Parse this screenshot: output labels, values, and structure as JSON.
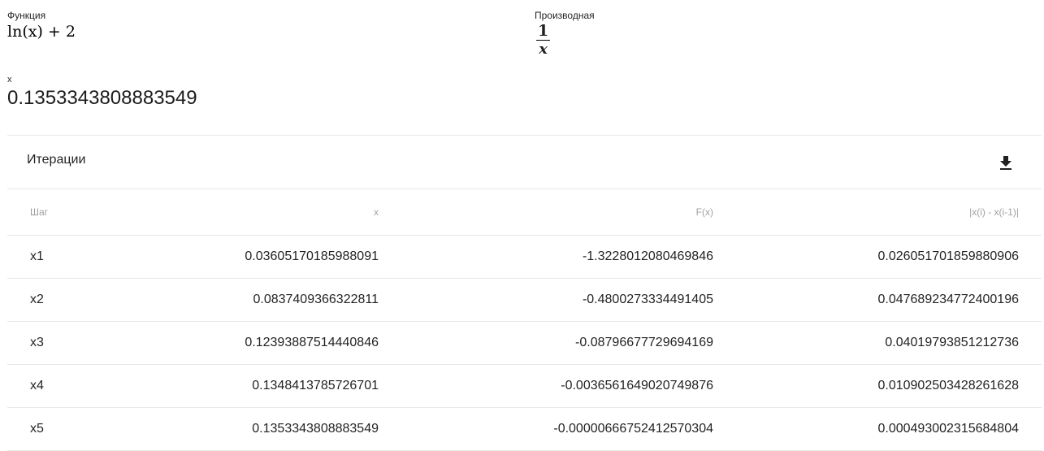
{
  "function": {
    "label": "Функция",
    "expression": "ln(x) + 2"
  },
  "derivative": {
    "label": "Производная",
    "numerator": "1",
    "denominator": "x"
  },
  "result": {
    "label": "x",
    "value": "0.1353343808883549"
  },
  "iterations": {
    "title": "Итерации",
    "download_icon": "download-icon",
    "columns": [
      "Шаг",
      "x",
      "F(x)",
      "|x(i) - x(i-1)|"
    ],
    "rows": [
      [
        "x1",
        "0.03605170185988091",
        "-1.3228012080469846",
        "0.026051701859880906"
      ],
      [
        "x2",
        "0.0837409366322811",
        "-0.4800273334491405",
        "0.047689234772400196"
      ],
      [
        "x3",
        "0.12393887514440846",
        "-0.08796677729694169",
        "0.04019793851212736"
      ],
      [
        "x4",
        "0.1348413785726701",
        "-0.0036561649020749876",
        "0.010902503428261628"
      ],
      [
        "x5",
        "0.1353343808883549",
        "-0.00000666752412570304",
        "0.00049300231568480​4"
      ]
    ]
  }
}
